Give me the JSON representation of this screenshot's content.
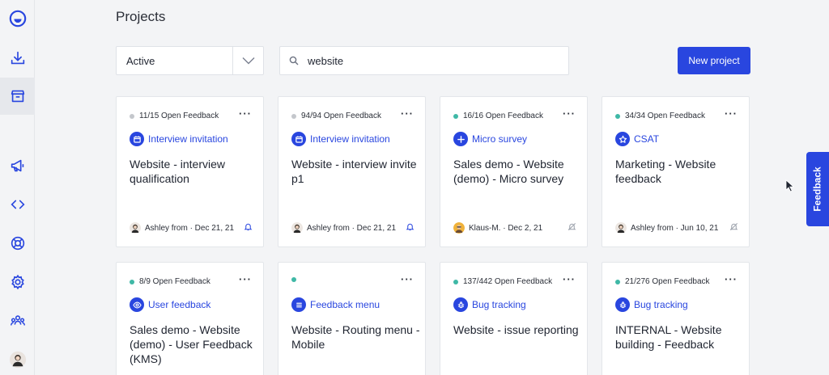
{
  "page": {
    "title": "Projects"
  },
  "filters": {
    "status_value": "Active",
    "search_value": "website",
    "new_project_label": "New project"
  },
  "sidebar": {
    "items": [
      {
        "icon": "logo-icon"
      },
      {
        "icon": "download-icon"
      },
      {
        "icon": "archive-icon",
        "active": true
      },
      {
        "icon": "megaphone-icon"
      },
      {
        "icon": "code-icon"
      },
      {
        "icon": "lifebuoy-icon"
      },
      {
        "icon": "gear-icon"
      },
      {
        "icon": "team-icon"
      },
      {
        "icon": "avatar"
      }
    ]
  },
  "cards": [
    {
      "feedback": "11/15 Open Feedback",
      "dot_color": "#c4c7cc",
      "type": "Interview invitation",
      "type_icon": "calendar-icon",
      "title": "Website - interview qualification",
      "author": "Ashley from · Dec 21, 21",
      "status_icon": "bell-icon"
    },
    {
      "feedback": "94/94 Open Feedback",
      "dot_color": "#c4c7cc",
      "type": "Interview invitation",
      "type_icon": "calendar-icon",
      "title": "Website - interview invite p1",
      "author": "Ashley from · Dec 21, 21",
      "status_icon": "bell-icon"
    },
    {
      "feedback": "16/16 Open Feedback",
      "dot_color": "#3fb8a6",
      "type": "Micro survey",
      "type_icon": "plus-icon",
      "title": "Sales demo - Website (demo) - Micro survey",
      "author": "Klaus-M. · Dec 2, 21",
      "status_icon": "bell-off-icon"
    },
    {
      "feedback": "34/34 Open Feedback",
      "dot_color": "#3fb8a6",
      "type": "CSAT",
      "type_icon": "star-icon",
      "title": "Marketing - Website feedback",
      "author": "Ashley from · Jun 10, 21",
      "status_icon": "bell-off-icon"
    },
    {
      "feedback": "8/9 Open Feedback",
      "dot_color": "#3fb8a6",
      "type": "User feedback",
      "type_icon": "eye-icon",
      "title": "Sales demo - Website (demo) - User Feedback (KMS)"
    },
    {
      "feedback": "",
      "dot_color": "#3fb8a6",
      "type": "Feedback menu",
      "type_icon": "menu-icon",
      "title": "Website - Routing menu - Mobile"
    },
    {
      "feedback": "137/442 Open Feedback",
      "dot_color": "#3fb8a6",
      "type": "Bug tracking",
      "type_icon": "bug-icon",
      "title": "Website - issue reporting"
    },
    {
      "feedback": "21/276 Open Feedback",
      "dot_color": "#3fb8a6",
      "type": "Bug tracking",
      "type_icon": "bug-icon",
      "title": "INTERNAL - Website building - Feedback"
    }
  ],
  "feedback_tab": {
    "label": "Feedback"
  },
  "colors": {
    "accent": "#2946df",
    "active_dot": "#3fb8a6",
    "inactive_dot": "#c4c7cc"
  }
}
